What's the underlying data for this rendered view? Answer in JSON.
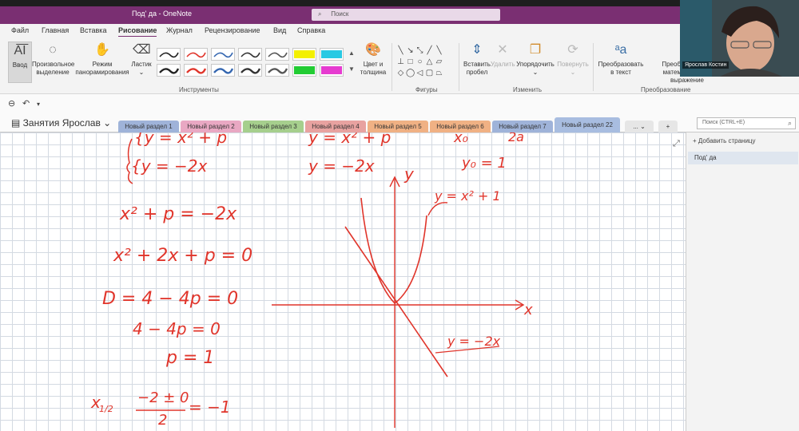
{
  "window": {
    "title": "Под' да - OneNote",
    "search_placeholder": "Поиск"
  },
  "menu": {
    "tabs": [
      {
        "label": "Файл"
      },
      {
        "label": "Главная"
      },
      {
        "label": "Вставка"
      },
      {
        "label": "Рисование"
      },
      {
        "label": "Журнал"
      },
      {
        "label": "Рецензирование"
      },
      {
        "label": "Вид"
      },
      {
        "label": "Справка"
      }
    ],
    "active_tab": "Рисование"
  },
  "ribbon": {
    "buttons": {
      "input": "Ввод",
      "free_select": "Произвольное выделение",
      "pan_mode": "Режим панорамирования",
      "eraser": "Ластик",
      "color_thickness": "Цвет и толщина",
      "insert_space": "Вставить пробел",
      "delete": "Удалить",
      "arrange": "Упорядочить",
      "rotate": "Повернуть",
      "ink_to_text": "Преобразовать в текст",
      "ink_to_math": "Преобразовать в математическое выражение"
    },
    "groups": {
      "tools": "Инструменты",
      "shapes": "Фигуры",
      "edit": "Изменить",
      "convert": "Преобразование"
    },
    "pen_colors": [
      "#222222",
      "#e0352b",
      "#3466b0",
      "#333333",
      "#555555",
      "#f3f000",
      "#28c9e3",
      "#222222",
      "#e0352b",
      "#3466b0",
      "#333333",
      "#555555",
      "#22cc33",
      "#e63bd0"
    ]
  },
  "notebook": {
    "name": "Занятия Ярослав",
    "sections": [
      {
        "label": "Новый раздел 1",
        "color": "#9fb3d9"
      },
      {
        "label": "Новый раздел 2",
        "color": "#e9a8c3"
      },
      {
        "label": "Новый раздел 3",
        "color": "#a6cf8d"
      },
      {
        "label": "Новый раздел 4",
        "color": "#e8a2a0"
      },
      {
        "label": "Новый раздел 5",
        "color": "#f0b184"
      },
      {
        "label": "Новый раздел 6",
        "color": "#f0b184"
      },
      {
        "label": "Новый раздел 7",
        "color": "#9fb3d9"
      },
      {
        "label": "Новый раздел 22",
        "color": "#a8bde0"
      }
    ],
    "more_label": "...",
    "add_label": "+",
    "search_placeholder": "Поиск (CTRL+E)"
  },
  "pages": {
    "add_label": "Добавить страницу",
    "items": [
      {
        "label": "Под' да"
      }
    ]
  },
  "webcam": {
    "participant_name": "Ярослав Костин"
  },
  "ink": {
    "top_left_1": "{y = x² + p",
    "top_left_2": "{y = −2x",
    "eq1": "x² + p = −2x",
    "eq2": "x² + 2x + p = 0",
    "eq3": "D = 4 − 4p  = 0",
    "eq4": "4 − 4p = 0",
    "eq5": "p = 1",
    "eq6": "x",
    "eq6_sub": "1/2",
    "eq6_frac_num": "−2 ± 0",
    "eq6_frac_den": "2",
    "eq6_result": "= −1",
    "mid_top_1": "y = x² + p",
    "mid_top_2": "y = −2x",
    "right_top_1": "x₀",
    "right_top_2": "y₀ = 1",
    "right_top_3": "2a",
    "graph_y": "y",
    "graph_x": "x",
    "parabola_label": "y = x² + 1",
    "line_label": "y = −2x"
  }
}
